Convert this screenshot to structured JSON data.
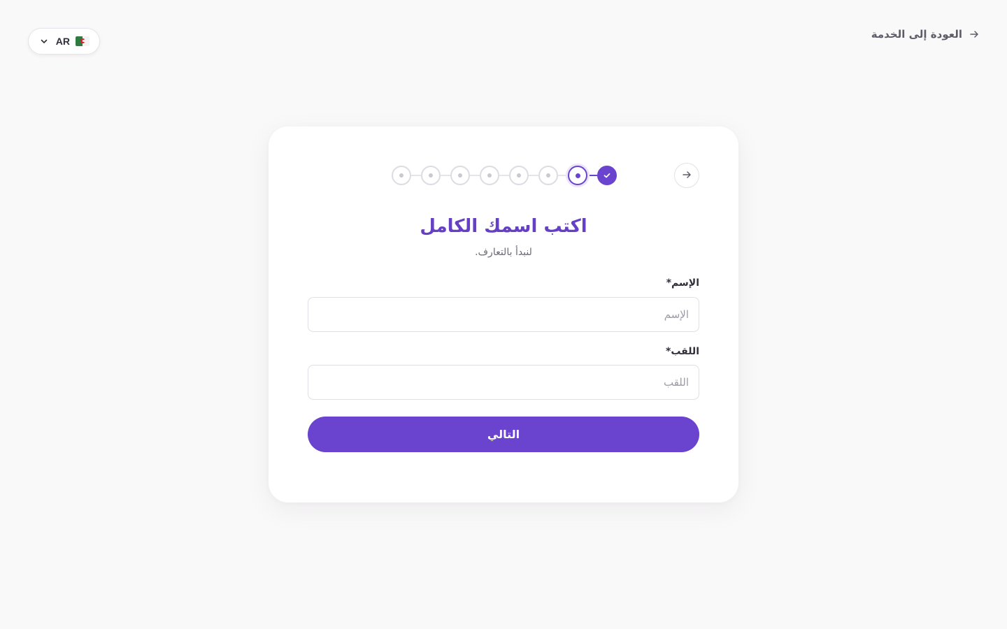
{
  "language": {
    "code": "AR",
    "flag_icon": "algeria-flag-icon"
  },
  "back_link": {
    "label": "العودة إلى الخدمة"
  },
  "stepper": {
    "total_steps": 8,
    "completed_steps": 1,
    "current_step": 2,
    "accent_color": "#6a43cf"
  },
  "form": {
    "title": "اكتب اسمك الكامل",
    "subtitle": "لنبدأ بالتعارف.",
    "first_name": {
      "label": "الإسم*",
      "placeholder": "الإسم",
      "value": ""
    },
    "last_name": {
      "label": "اللقب*",
      "placeholder": "اللقب",
      "value": ""
    },
    "next_label": "التالي"
  }
}
